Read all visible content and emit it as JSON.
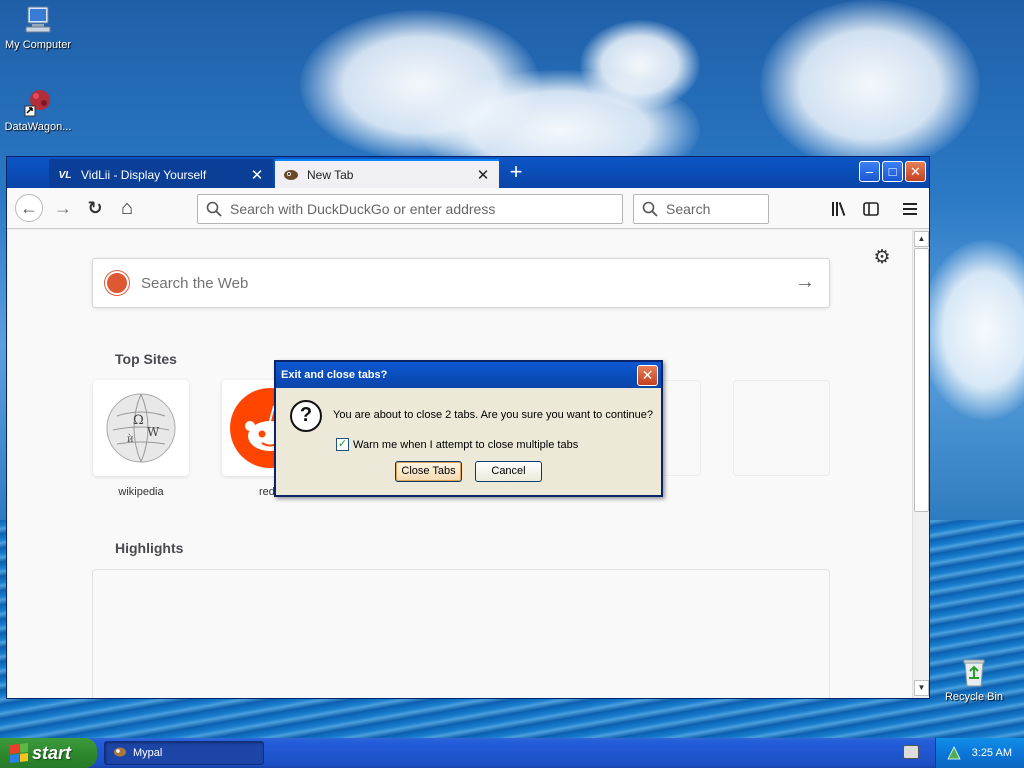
{
  "desktop": {
    "icons": [
      {
        "label": "My Computer"
      },
      {
        "label": "DataWagon..."
      },
      {
        "label": "Recycle Bin"
      }
    ]
  },
  "browser": {
    "tabs": [
      {
        "label": "VidLii - Display Yourself",
        "favicon": "VL",
        "active": false
      },
      {
        "label": "New Tab",
        "favicon": "browser-logo",
        "active": true
      }
    ],
    "newtab_glyph": "+",
    "window_buttons": {
      "minimize": "–",
      "maximize": "□",
      "close": "✕"
    },
    "nav": {
      "back": "←",
      "forward": "→",
      "reload": "↻",
      "home": "⌂"
    },
    "urlbar": {
      "placeholder": "Search with DuckDuckGo or enter address"
    },
    "searchbar": {
      "placeholder": "Search"
    },
    "toolbar_icons": [
      "library-icon",
      "sidebar-icon",
      "menu-icon"
    ]
  },
  "newtab": {
    "search_placeholder": "Search the Web",
    "top_sites_title": "Top Sites",
    "top_sites": [
      {
        "label": "wikipedia"
      },
      {
        "label": "redd"
      }
    ],
    "highlights_title": "Highlights"
  },
  "dialog": {
    "title": "Exit and close tabs?",
    "message": "You are about to close 2 tabs. Are you sure you want to continue?",
    "checkbox_label": "Warn me when I attempt to close multiple tabs",
    "checkbox_checked": true,
    "confirm_label": "Close Tabs",
    "cancel_label": "Cancel"
  },
  "taskbar": {
    "start_label": "start",
    "items": [
      {
        "label": "Mypal"
      }
    ],
    "clock": "3:25 AM"
  },
  "colors": {
    "accent_tab": "#0a84ff",
    "xp_titlebar": "#0b58d2",
    "duckduckgo": "#de5833",
    "reddit": "#ff4500"
  }
}
